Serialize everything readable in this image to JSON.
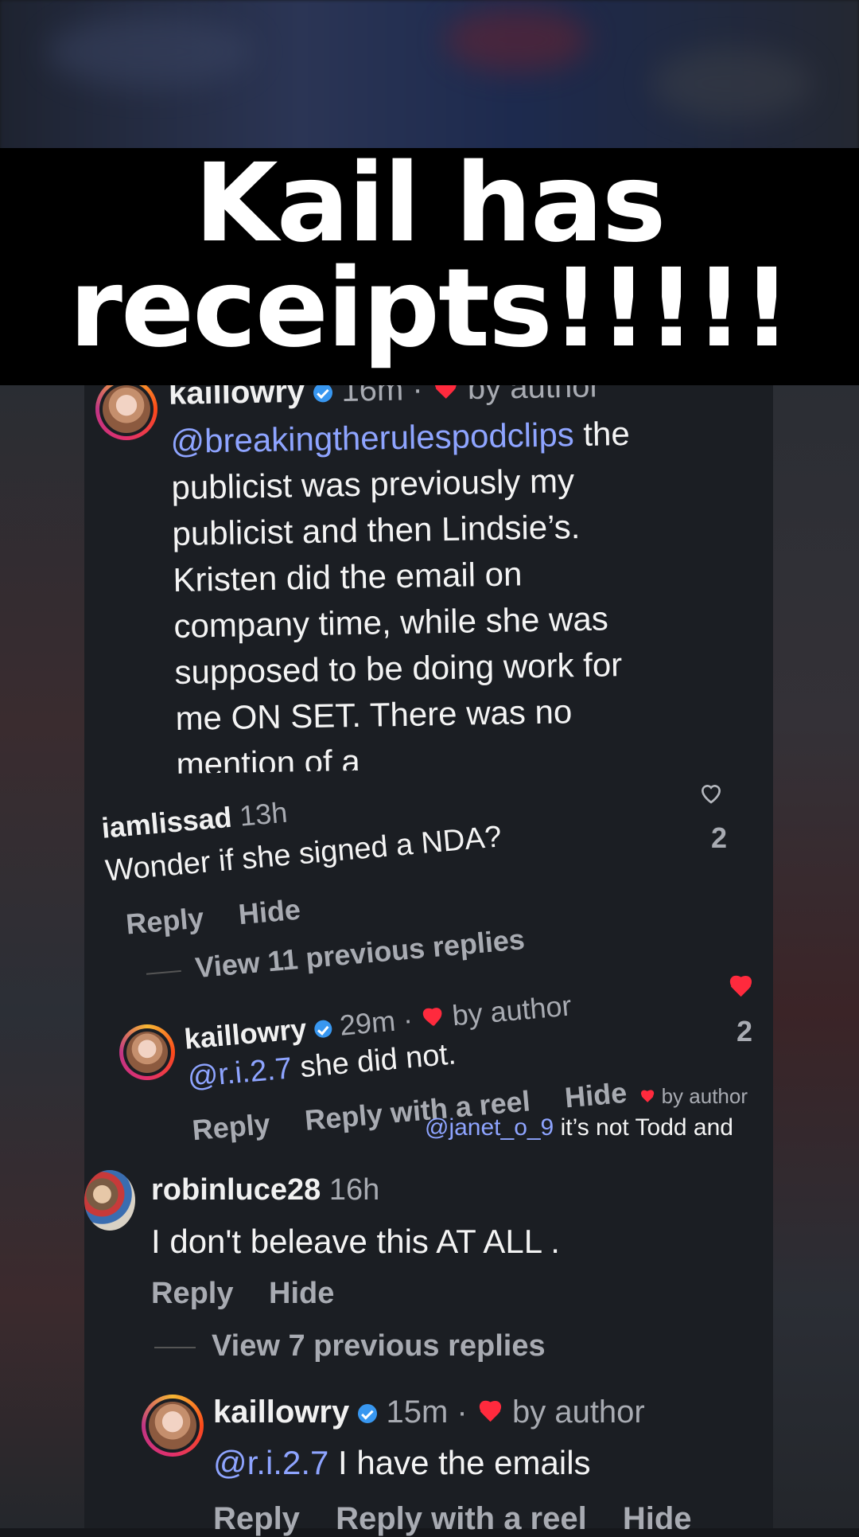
{
  "headline": {
    "line1": "Kail has",
    "line2": "receipts!!!!!"
  },
  "top_comment": {
    "username": "kaillowry",
    "time": "16m",
    "dot": "·",
    "liked_by": "by author",
    "mention": "@breakingtherulespodclips",
    "text_lines": [
      " the",
      "publicist was previously my",
      "publicist and then Lindsie’s.",
      "Kristen did the email on",
      "company time, while she was",
      "supposed to be doing work for",
      "me ON SET. There was no",
      "mention of a"
    ]
  },
  "comment_lissad": {
    "username": "iamlissad",
    "time": "13h",
    "text": "Wonder if she signed a NDA?",
    "like_count": "2",
    "reply_label": "Reply",
    "hide_label": "Hide",
    "view_replies": "View 11 previous replies"
  },
  "reply_kail_1": {
    "username": "kaillowry",
    "time": "29m",
    "dot": "·",
    "liked_by": "by author",
    "mention": "@r.i.2.7",
    "text": " she did not.",
    "like_count": "2",
    "reply_label": "Reply",
    "reel_label": "Reply with a reel",
    "hide_label": "Hide"
  },
  "overlay_snippet": {
    "liked_by": "by author",
    "mention": "@janet_o_9",
    "text": " it’s not Todd and"
  },
  "comment_robin": {
    "username": "robinluce28",
    "time": "16h",
    "text": "I don't beleave this AT ALL .",
    "reply_label": "Reply",
    "hide_label": "Hide",
    "view_replies": "View 7 previous replies"
  },
  "reply_kail_2": {
    "username": "kaillowry",
    "time": "15m",
    "dot": "·",
    "liked_by": "by author",
    "mention": "@r.i.2.7",
    "text": " I have the emails",
    "reply_label": "Reply",
    "reel_label": "Reply with a reel",
    "hide_label": "Hide"
  },
  "colors": {
    "mention": "#8ea4ff",
    "heart": "#ff2a3d",
    "verified": "#3897f0",
    "banner": "#000000"
  }
}
